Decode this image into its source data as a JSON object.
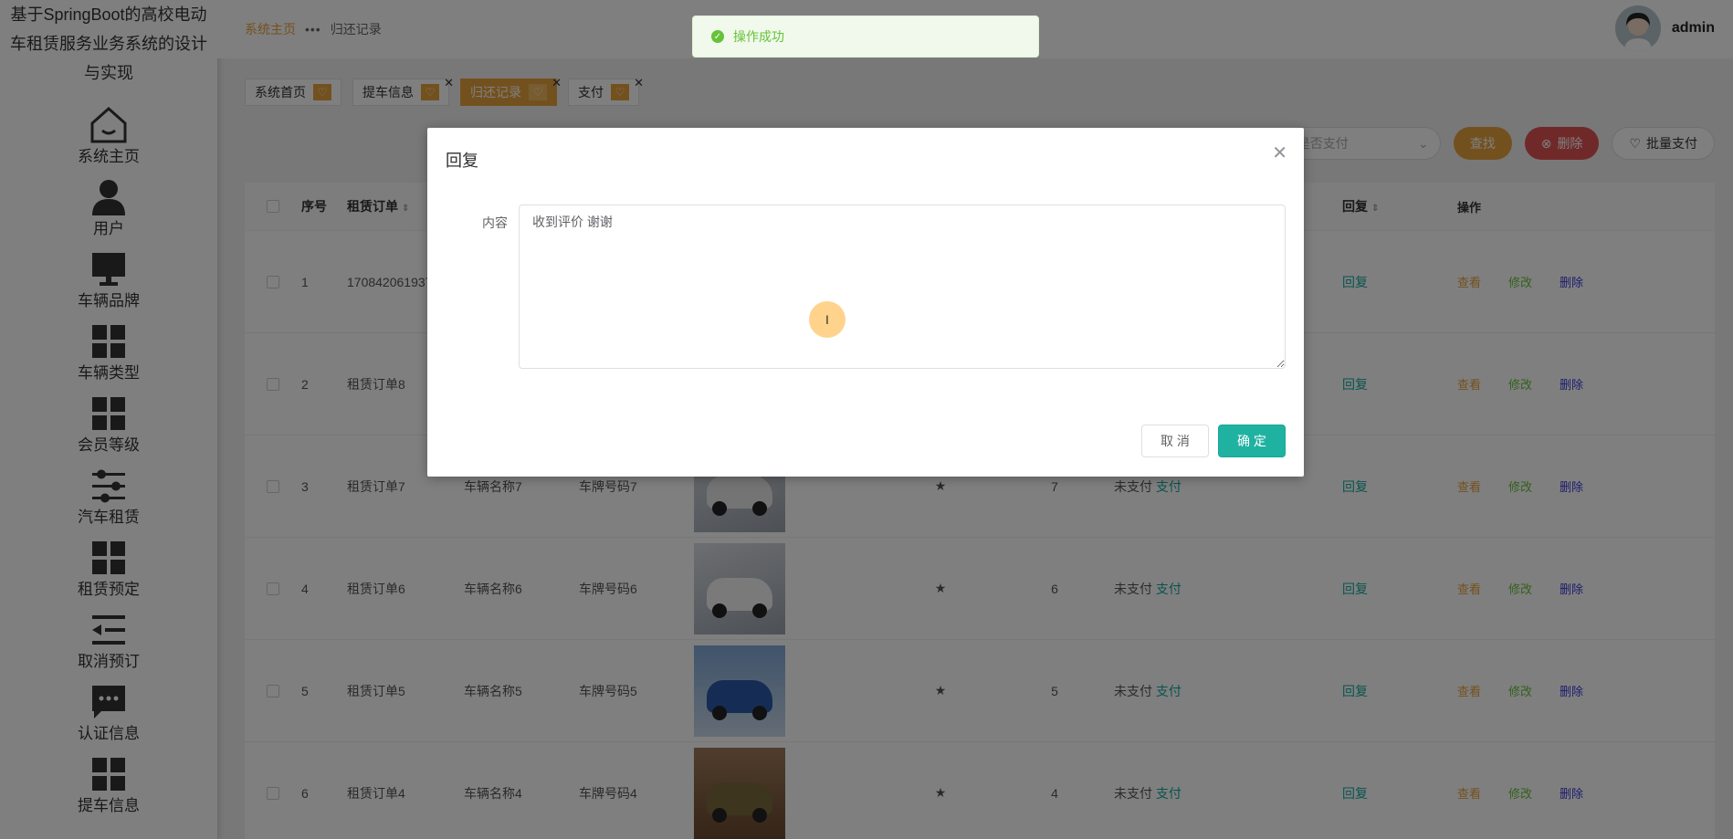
{
  "sidebar": {
    "title": "基于SpringBoot的高校电动车租赁服务业务系统的设计与实现",
    "items": [
      {
        "label": "系统主页",
        "icon": "home-icon"
      },
      {
        "label": "用户",
        "icon": "user-icon"
      },
      {
        "label": "车辆品牌",
        "icon": "monitor-icon"
      },
      {
        "label": "车辆类型",
        "icon": "grid-icon"
      },
      {
        "label": "会员等级",
        "icon": "grid-icon"
      },
      {
        "label": "汽车租赁",
        "icon": "sliders-icon"
      },
      {
        "label": "租赁预定",
        "icon": "grid-icon"
      },
      {
        "label": "取消预订",
        "icon": "list-indent-icon"
      },
      {
        "label": "认证信息",
        "icon": "chat-icon"
      },
      {
        "label": "提车信息",
        "icon": "grid-icon"
      }
    ]
  },
  "header": {
    "breadcrumb_home": "系统主页",
    "breadcrumb_sep": "•••",
    "breadcrumb_current": "归还记录",
    "username": "admin"
  },
  "tags": [
    {
      "label": "系统首页",
      "active": false,
      "closable": false
    },
    {
      "label": "提车信息",
      "active": false,
      "closable": true
    },
    {
      "label": "归还记录",
      "active": true,
      "closable": true
    },
    {
      "label": "支付",
      "active": false,
      "closable": true
    }
  ],
  "search": {
    "select_placeholder": "是否支付",
    "find_label": "查找",
    "delete_label": "删除",
    "batch_pay_label": "批量支付"
  },
  "table": {
    "headers": {
      "no": "序号",
      "order": "租赁订单",
      "reply": "回复",
      "ops": "操作"
    },
    "rows": [
      {
        "no": "1",
        "order": "170842061937",
        "name": "",
        "plate": "",
        "star": "",
        "num": "",
        "pay_status": "",
        "pay_action": "",
        "reply": "回复",
        "view": "查看",
        "edit": "修改",
        "del": "删除"
      },
      {
        "no": "2",
        "order": "租赁订单8",
        "name": "",
        "plate": "",
        "star": "",
        "num": "",
        "pay_status": "",
        "pay_action": "",
        "reply": "回复",
        "view": "查看",
        "edit": "修改",
        "del": "删除"
      },
      {
        "no": "3",
        "order": "租赁订单7",
        "name": "车辆名称7",
        "plate": "车牌号码7",
        "star": "★",
        "num": "7",
        "pay_status": "未支付",
        "pay_action": "支付",
        "reply": "回复",
        "view": "查看",
        "edit": "修改",
        "del": "删除"
      },
      {
        "no": "4",
        "order": "租赁订单6",
        "name": "车辆名称6",
        "plate": "车牌号码6",
        "star": "★",
        "num": "6",
        "pay_status": "未支付",
        "pay_action": "支付",
        "reply": "回复",
        "view": "查看",
        "edit": "修改",
        "del": "删除"
      },
      {
        "no": "5",
        "order": "租赁订单5",
        "name": "车辆名称5",
        "plate": "车牌号码5",
        "star": "★",
        "num": "5",
        "pay_status": "未支付",
        "pay_action": "支付",
        "reply": "回复",
        "view": "查看",
        "edit": "修改",
        "del": "删除"
      },
      {
        "no": "6",
        "order": "租赁订单4",
        "name": "车辆名称4",
        "plate": "车牌号码4",
        "star": "★",
        "num": "4",
        "pay_status": "未支付",
        "pay_action": "支付",
        "reply": "回复",
        "view": "查看",
        "edit": "修改",
        "del": "删除"
      }
    ]
  },
  "toast": {
    "message": "操作成功"
  },
  "dialog": {
    "title": "回复",
    "content_label": "内容",
    "content_value": "收到评价 谢谢",
    "cancel_label": "取 消",
    "ok_label": "确 定"
  },
  "colors": {
    "accent": "#e6a23c",
    "primary_ok": "#20b2a0",
    "danger": "#e05252",
    "success": "#67c23a"
  }
}
